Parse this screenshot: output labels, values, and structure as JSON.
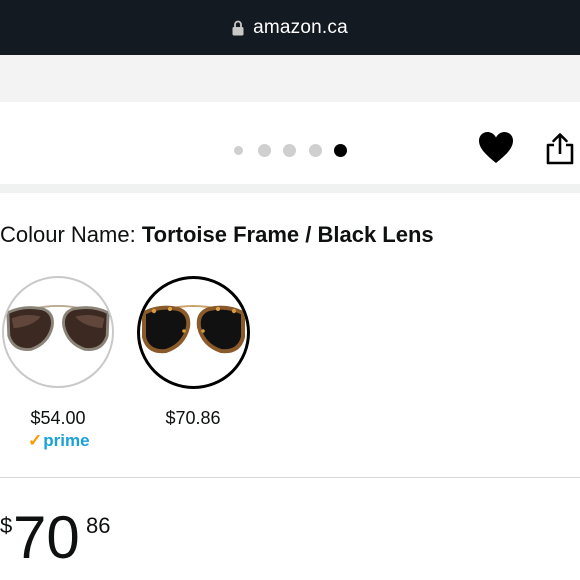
{
  "browser": {
    "url": "amazon.ca"
  },
  "gallery": {
    "dot_count": 5,
    "active_index": 4
  },
  "colour": {
    "label": "Colour Name: ",
    "value": "Tortoise Frame / Black Lens"
  },
  "swatches": [
    {
      "price": "$54.00",
      "prime_label": "prime",
      "selected": false
    },
    {
      "price": "$70.86",
      "selected": true
    }
  ],
  "price": {
    "currency": "$",
    "whole": "70",
    "fraction": "86"
  },
  "colors": {
    "topbar": "#131a22",
    "prime_blue": "#1aa1d8",
    "prime_check": "#ff9900"
  },
  "icons": [
    "lock-icon",
    "heart-icon",
    "share-icon"
  ]
}
